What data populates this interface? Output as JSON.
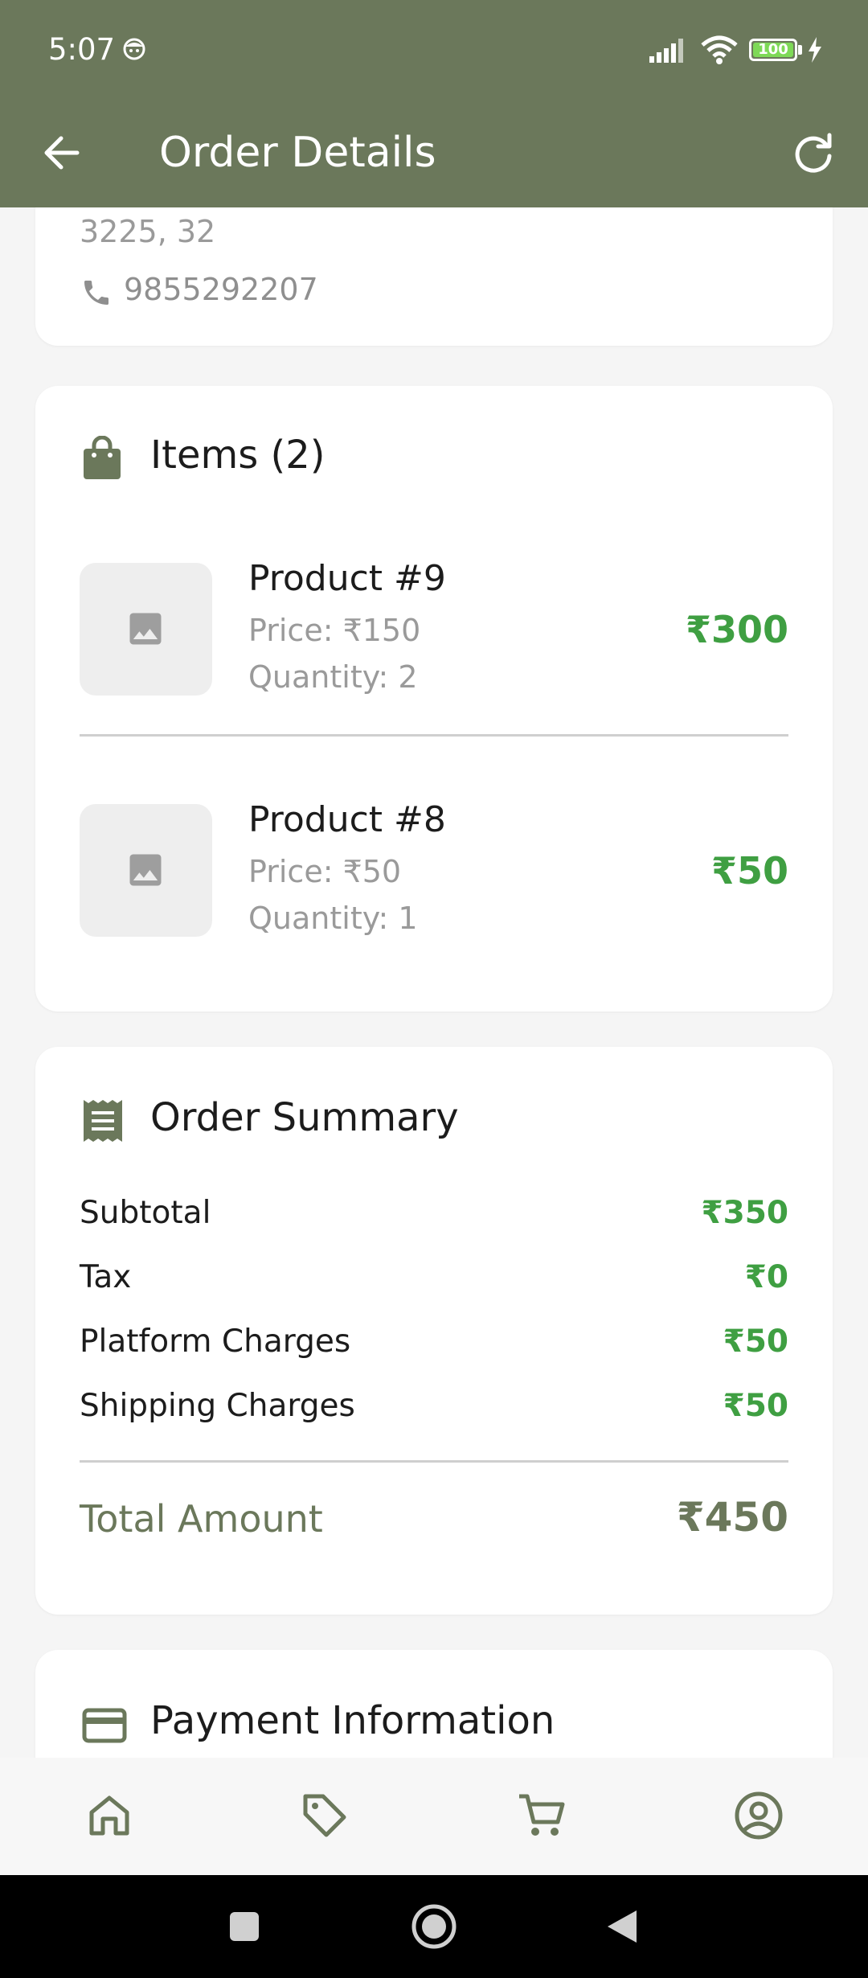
{
  "status_bar": {
    "time": "5:07",
    "battery": "100",
    "icons": [
      "face-icon",
      "signal-icon",
      "wifi-icon",
      "battery-icon",
      "charging-bolt-icon"
    ]
  },
  "app_bar": {
    "title": "Order Details",
    "back_icon": "arrow-left-icon",
    "refresh_icon": "refresh-icon"
  },
  "address": {
    "line": "3225, 32",
    "phone": "9855292207"
  },
  "items_section": {
    "title": "Items (2)",
    "icon": "shopping-bag-icon",
    "items": [
      {
        "name": "Product #9",
        "price": "Price: ₹150",
        "quantity": "Quantity: 2",
        "total": "₹300"
      },
      {
        "name": "Product #8",
        "price": "Price: ₹50",
        "quantity": "Quantity: 1",
        "total": "₹50"
      }
    ]
  },
  "summary": {
    "title": "Order Summary",
    "icon": "receipt-icon",
    "rows": [
      {
        "label": "Subtotal",
        "value": "₹350"
      },
      {
        "label": "Tax",
        "value": "₹0"
      },
      {
        "label": "Platform Charges",
        "value": "₹50"
      },
      {
        "label": "Shipping Charges",
        "value": "₹50"
      }
    ],
    "total_label": "Total Amount",
    "total_value": "₹450"
  },
  "payment": {
    "title": "Payment Information",
    "icon": "credit-card-icon"
  },
  "bottom_nav": [
    "home-icon",
    "tag-icon",
    "cart-icon",
    "account-icon"
  ],
  "colors": {
    "primary": "#6b785b",
    "accent_green": "#3f9f42",
    "background": "#f5f5f5"
  }
}
